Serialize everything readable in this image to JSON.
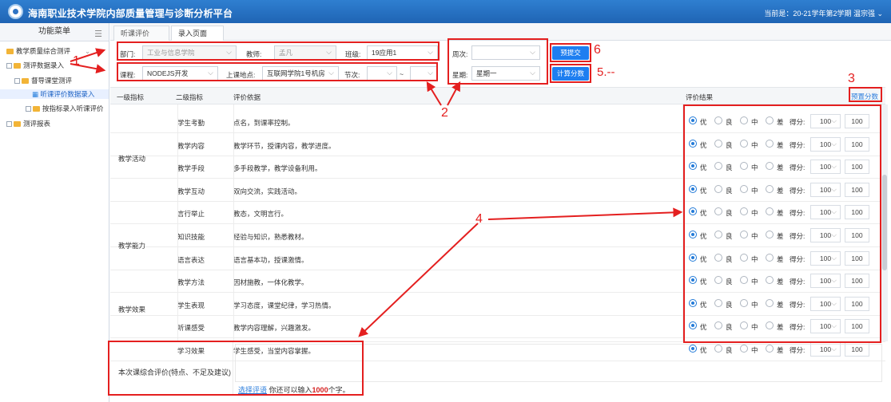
{
  "app": {
    "title": "海南职业技术学院内部质量管理与诊断分析平台",
    "term": "当前是：20-21学年第2学期 温宗强 ⌄"
  },
  "sidebar": {
    "title": "功能菜单",
    "items": [
      {
        "label": "教学质量综合测评"
      },
      {
        "label": "测评数据录入"
      },
      {
        "label": "督导课堂测评"
      },
      {
        "label": "听课评价数据录入"
      },
      {
        "label": "按指标录入听课评价"
      },
      {
        "label": "测评报表"
      }
    ]
  },
  "tabs": [
    {
      "label": "听课评价数..."
    },
    {
      "label": "录入页面"
    }
  ],
  "form": {
    "dept_label": "部门:",
    "dept": "工业与信息学院",
    "teacher_label": "教师:",
    "teacher": "孟凡",
    "class_label": "班级:",
    "class": "19应用1",
    "week_label": "周次:",
    "week": "",
    "course_label": "课程:",
    "course": "NODEJS开发",
    "place_label": "上课地点:",
    "place": "互联网学院1号机房",
    "period_label": "节次:",
    "period": "",
    "period_sep": "~",
    "weekday_label": "星期:",
    "weekday": "星期一",
    "pre_submit": "预提交",
    "calc": "计算分数"
  },
  "annotations": {
    "one": "1",
    "two": "2",
    "three": "3",
    "four": "4",
    "five": "5.--",
    "six": "6"
  },
  "table": {
    "headers": [
      "一级指标",
      "二级指标",
      "评价依据",
      "评价结果"
    ],
    "preset": "预置分数",
    "groups": [
      {
        "label": "教学活动"
      },
      {
        "label": "教学能力"
      },
      {
        "label": "教学效果"
      }
    ],
    "rows": [
      {
        "second": "学生考勤",
        "basis": "点名，到课率控制。"
      },
      {
        "second": "教学内容",
        "basis": "教学环节，授课内容，教学进度。"
      },
      {
        "second": "教学手段",
        "basis": "多手段教学，教学设备利用。"
      },
      {
        "second": "教学互动",
        "basis": "双向交流，实践活动。"
      },
      {
        "second": "言行举止",
        "basis": "教态，文明言行。"
      },
      {
        "second": "知识技能",
        "basis": "经验与知识，熟悉教材。"
      },
      {
        "second": "语言表达",
        "basis": "语言基本功，授课激情。"
      },
      {
        "second": "教学方法",
        "basis": "因材施教，一体化教学。"
      },
      {
        "second": "学生表现",
        "basis": "学习态度，课堂纪律，学习热情。"
      },
      {
        "second": "听课感受",
        "basis": "教学内容理解，兴趣激发。"
      },
      {
        "second": "学习效果",
        "basis": "学生感受，当堂内容掌握。"
      }
    ],
    "ratings": [
      "优",
      "良",
      "中",
      "差"
    ],
    "score_label": "得分:",
    "score_select": "100",
    "score_value": "100"
  },
  "comment": {
    "label": "本次课综合评价(特点、不足及建议)",
    "select_link": "选择评语",
    "hint_prefix": "你还可以输入",
    "remaining": "1000",
    "hint_suffix": "个字。"
  }
}
